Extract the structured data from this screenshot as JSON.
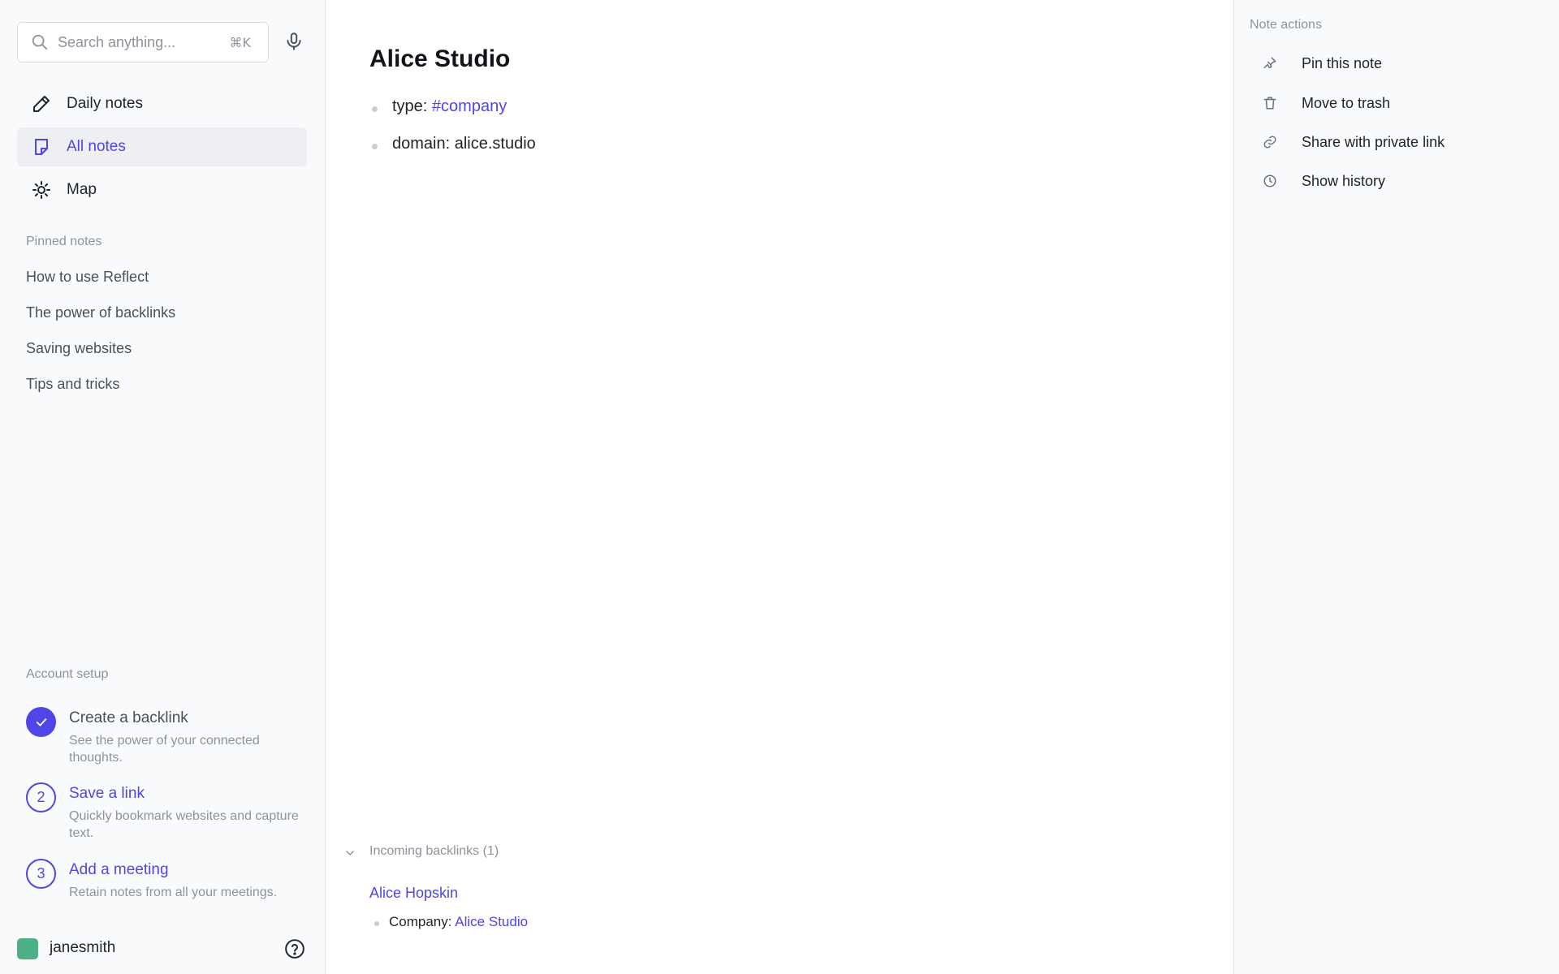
{
  "search": {
    "placeholder": "Search anything...",
    "shortcut": "⌘K"
  },
  "nav": [
    {
      "label": "Daily notes",
      "icon": "pencil-icon"
    },
    {
      "label": "All notes",
      "icon": "note-icon",
      "active": true
    },
    {
      "label": "Map",
      "icon": "sun-icon"
    }
  ],
  "pinned": {
    "label": "Pinned notes",
    "items": [
      "How to use Reflect",
      "The power of backlinks",
      "Saving websites",
      "Tips and tricks"
    ]
  },
  "setup": {
    "label": "Account setup",
    "steps": [
      {
        "badge": "✓",
        "title": "Create a backlink",
        "desc": "See the power of your connected thoughts.",
        "done": true
      },
      {
        "badge": "2",
        "title": "Save a link",
        "desc": "Quickly bookmark websites and capture text.",
        "done": false
      },
      {
        "badge": "3",
        "title": "Add a meeting",
        "desc": "Retain notes from all your meetings.",
        "done": false
      }
    ]
  },
  "user": {
    "name": "janesmith"
  },
  "note": {
    "title": "Alice Studio",
    "bullets": [
      {
        "key": "type:",
        "value": "#company"
      },
      {
        "key": "domain:",
        "value": "alice.studio"
      }
    ]
  },
  "backlinks": {
    "header": "Incoming backlinks (1)",
    "items": [
      {
        "title": "Alice Hopskin",
        "key": "Company:",
        "value": "Alice Studio"
      }
    ]
  },
  "actions": {
    "label": "Note actions",
    "items": [
      {
        "label": "Pin this note",
        "icon": "pin-icon"
      },
      {
        "label": "Move to trash",
        "icon": "trash-icon"
      },
      {
        "label": "Share with private link",
        "icon": "link-icon"
      },
      {
        "label": "Show history",
        "icon": "clock-icon"
      }
    ]
  },
  "colors": {
    "accent": "#4f46e5",
    "avatar": "#4caf85"
  }
}
